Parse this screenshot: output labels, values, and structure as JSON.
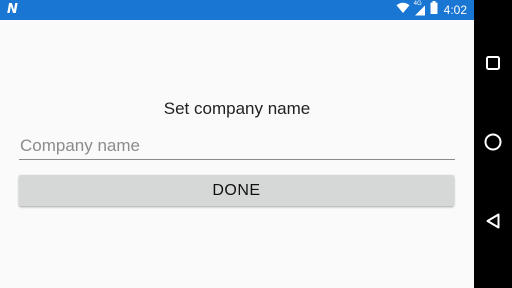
{
  "status_bar": {
    "app_glyph": "N",
    "network_type": "4G",
    "time": "4:02",
    "icons": [
      "n-notification-icon",
      "wifi-icon",
      "cellular-signal-icon",
      "battery-icon"
    ]
  },
  "screen": {
    "title": "Set company name",
    "company_input": {
      "value": "",
      "placeholder": "Company name"
    },
    "done_label": "DONE"
  },
  "nav_bar": {
    "buttons": [
      "recent-apps",
      "home",
      "back"
    ]
  },
  "colors": {
    "status_bar": "#1976d2",
    "background": "#fafafa",
    "button": "#d6d7d7",
    "nav_bar": "#000000"
  }
}
